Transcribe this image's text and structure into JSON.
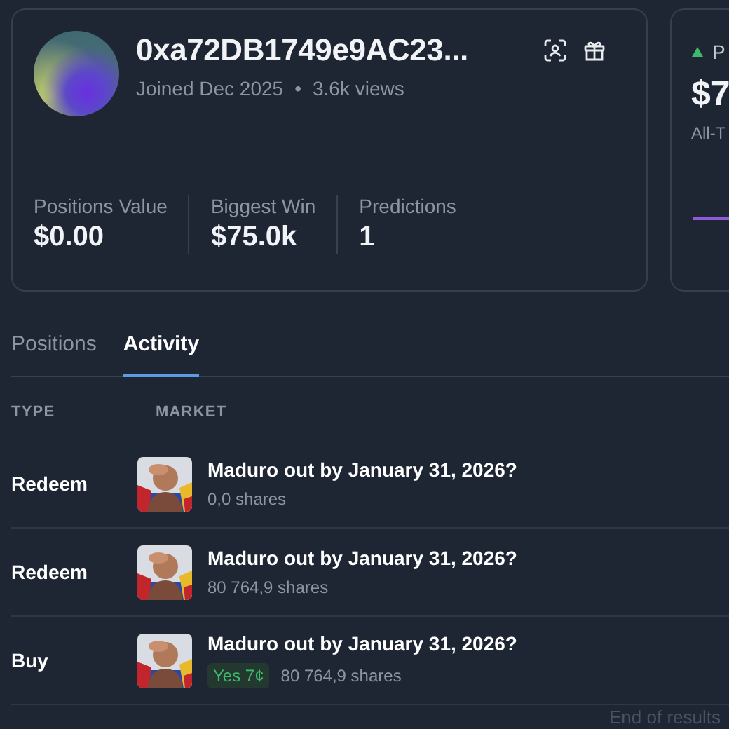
{
  "profile": {
    "name": "0xa72DB1749e9AC23...",
    "joined": "Joined Dec 2025",
    "separator": "•",
    "views": "3.6k views",
    "stats": [
      {
        "label": "Positions Value",
        "value": "$0.00"
      },
      {
        "label": "Biggest Win",
        "value": "$75.0k"
      },
      {
        "label": "Predictions",
        "value": "1"
      }
    ]
  },
  "pnl_card": {
    "title": "P",
    "value": "$7",
    "period": "All-T"
  },
  "tabs": [
    {
      "label": "Positions",
      "selected": false
    },
    {
      "label": "Activity",
      "selected": true
    }
  ],
  "table": {
    "columns": [
      "TYPE",
      "MARKET"
    ],
    "rows": [
      {
        "type": "Redeem",
        "market": "Maduro out by January 31, 2026?",
        "shares": "0,0 shares"
      },
      {
        "type": "Redeem",
        "market": "Maduro out by January 31, 2026?",
        "shares": "80 764,9 shares"
      },
      {
        "type": "Buy",
        "market": "Maduro out by January 31, 2026?",
        "outcome": "Yes 7¢",
        "shares": "80 764,9 shares"
      }
    ]
  },
  "footer": "End of results"
}
